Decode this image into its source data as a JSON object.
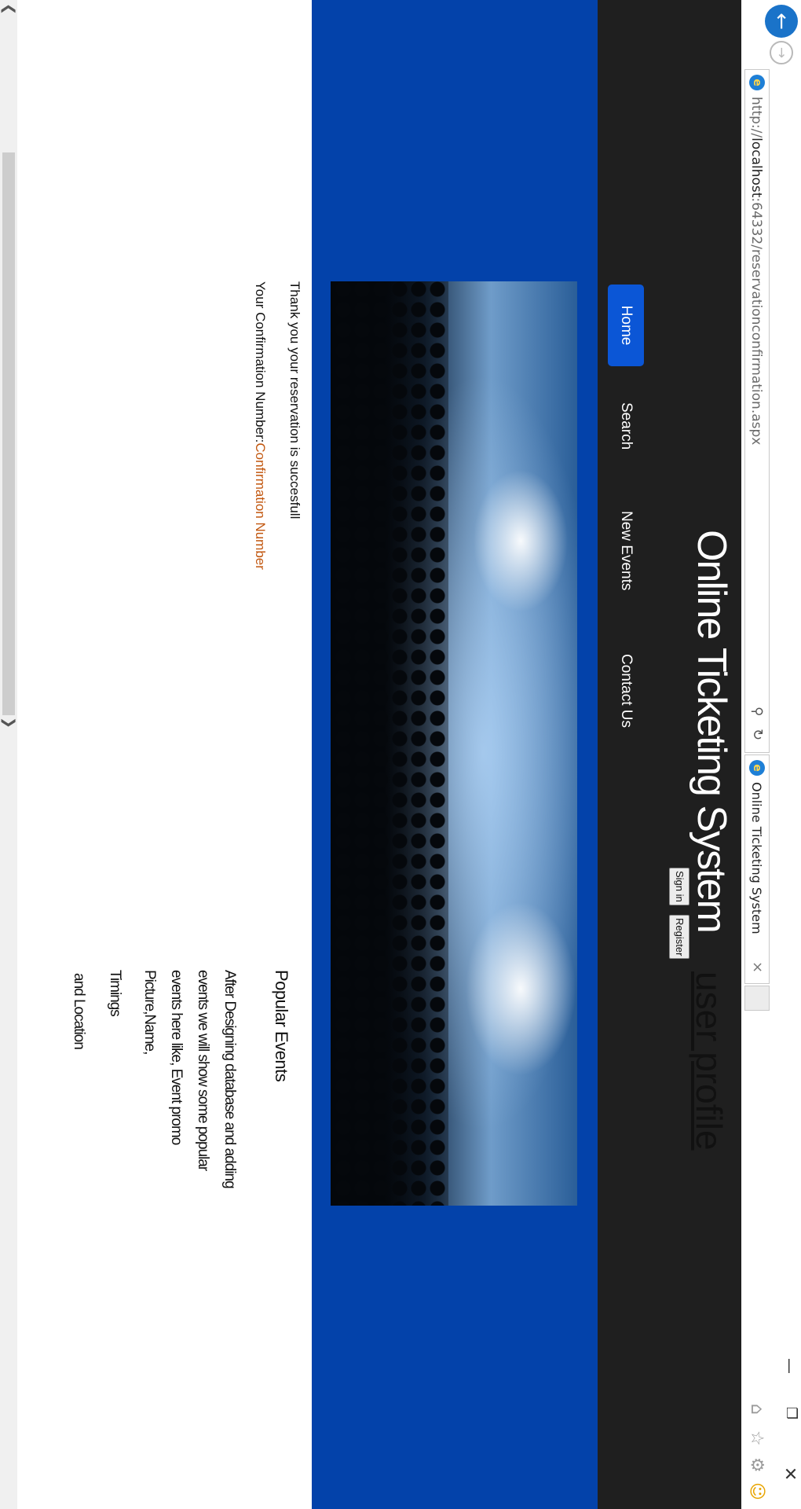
{
  "browser": {
    "url_prefix": "http://",
    "url_host": "localhost",
    "url_rest": ":64332/reservationconfirmation.aspx",
    "tab_title": "Online Ticketing System",
    "icons": {
      "back": "back-arrow-icon",
      "forward": "forward-arrow-icon",
      "ie": "ie-logo-icon",
      "search": "search-icon",
      "refresh": "refresh-icon",
      "tab_close": "close-icon",
      "home": "home-icon",
      "favorites": "star-icon",
      "settings": "gear-icon",
      "feedback": "smiley-icon",
      "minimize": "minimize-icon",
      "restore": "restore-icon",
      "close": "close-icon"
    }
  },
  "header": {
    "site_title": "Online Ticketing System",
    "signin_label": "Sign in",
    "register_label": "Register",
    "user_profile_label": "user profile"
  },
  "nav": {
    "items": [
      {
        "label": "Home",
        "active": true
      },
      {
        "label": "Search",
        "active": false
      },
      {
        "label": "New Events",
        "active": false
      },
      {
        "label": "Contact Us",
        "active": false
      }
    ]
  },
  "content": {
    "success_message": "Thank you your reservation is succesfull",
    "confirmation_label": "Your Confirmation Number:",
    "confirmation_number": "Confirmation Number"
  },
  "popular_events": {
    "title": "Popular Events",
    "lines": [
      "After Designing database and adding",
      "events we will show some popular",
      "events here like, Event promo",
      "Picture,Name,",
      "Timings",
      "and Location"
    ]
  },
  "colors": {
    "header_bg": "#1f1f1f",
    "banner_bg": "#0342aa",
    "nav_active": "#0b56d6",
    "confirmation_number": "#c2570f"
  }
}
